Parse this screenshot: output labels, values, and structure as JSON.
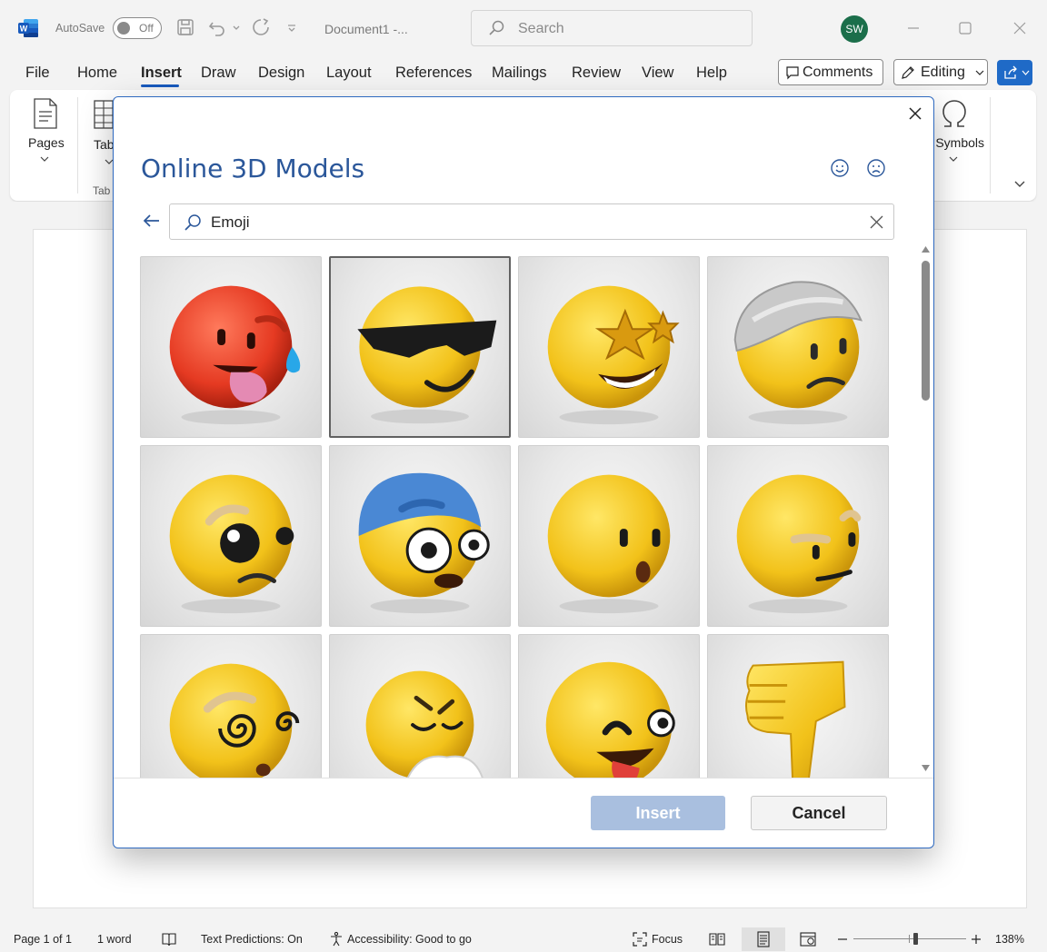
{
  "titlebar": {
    "autosave_label": "AutoSave",
    "autosave_state": "Off",
    "document_name": "Document1  -...",
    "search_placeholder": "Search",
    "avatar_initials": "SW"
  },
  "menu": {
    "tabs": [
      "File",
      "Home",
      "Insert",
      "Draw",
      "Design",
      "Layout",
      "References",
      "Mailings",
      "Review",
      "View",
      "Help"
    ],
    "active_tab": "Insert",
    "comments_label": "Comments",
    "editing_label": "Editing"
  },
  "ribbon": {
    "pages_label": "Pages",
    "tables_label": "Tab",
    "tables_group_label": "Tab",
    "symbols_label": "Symbols"
  },
  "dialog": {
    "title": "Online 3D Models",
    "search_value": "Emoji",
    "insert_label": "Insert",
    "cancel_label": "Cancel",
    "models": [
      {
        "icon": "hot-face-3d-model"
      },
      {
        "icon": "sunglasses-face-3d-model"
      },
      {
        "icon": "star-struck-face-3d-model"
      },
      {
        "icon": "bandaged-head-face-3d-model"
      },
      {
        "icon": "pleading-face-3d-model"
      },
      {
        "icon": "cold-cap-face-3d-model"
      },
      {
        "icon": "surprised-face-3d-model"
      },
      {
        "icon": "raised-eyebrow-face-3d-model"
      },
      {
        "icon": "dizzy-face-3d-model"
      },
      {
        "icon": "sneezing-face-3d-model"
      },
      {
        "icon": "zany-face-3d-model"
      },
      {
        "icon": "thumbs-down-3d-model"
      }
    ],
    "selected_index": 1
  },
  "statusbar": {
    "page": "Page 1 of 1",
    "words": "1 word",
    "text_predictions": "Text Predictions: On",
    "accessibility": "Accessibility: Good to go",
    "focus": "Focus",
    "zoom": "138%",
    "zoom_level_fraction": 0.55
  },
  "colors": {
    "accent": "#185abd",
    "dialog_title": "#2b579a",
    "insert_disabled": "#a9bfdf",
    "emoji_yellow": "#f5c518",
    "emoji_red": "#e8402c"
  }
}
